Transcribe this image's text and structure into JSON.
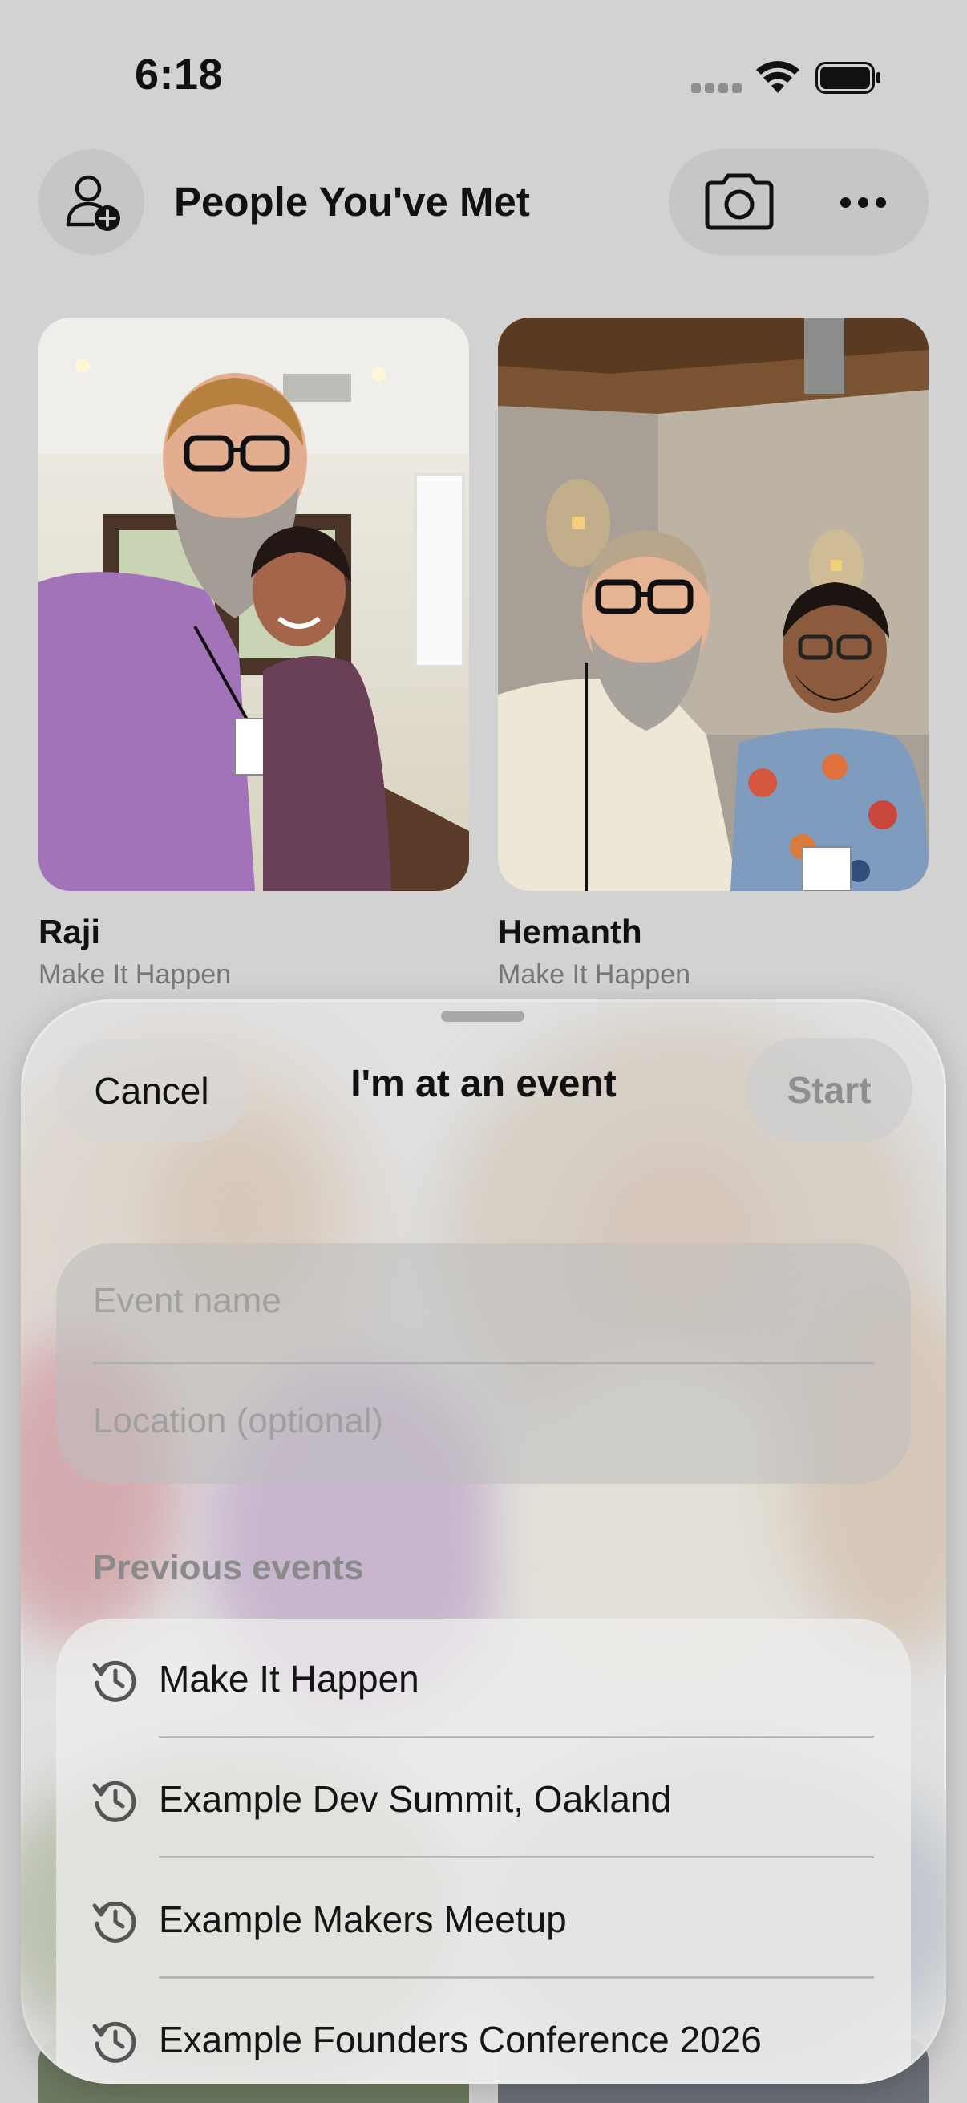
{
  "status_bar": {
    "time": "6:18"
  },
  "header": {
    "title": "People You've Met",
    "icons": [
      "person-add-icon",
      "camera-icon",
      "ellipsis-icon"
    ]
  },
  "contacts": [
    {
      "name": "Raji",
      "event": "Make It Happen"
    },
    {
      "name": "Hemanth",
      "event": "Make It Happen"
    }
  ],
  "sheet": {
    "cancel_label": "Cancel",
    "title": "I'm at an event",
    "start_label": "Start",
    "event_name_placeholder": "Event name",
    "location_placeholder": "Location (optional)",
    "previous_events_title": "Previous events",
    "previous_events": [
      {
        "label": "Make It Happen",
        "icon": "history-icon"
      },
      {
        "label": "Example Dev Summit, Oakland",
        "icon": "history-icon"
      },
      {
        "label": "Example Makers Meetup",
        "icon": "history-icon"
      },
      {
        "label": "Example Founders Conference 2026",
        "icon": "history-icon"
      }
    ]
  },
  "colors": {
    "background": "#d2d2d2",
    "text_primary": "#111111",
    "text_secondary": "#777777",
    "disabled": "#8e8e8e"
  }
}
